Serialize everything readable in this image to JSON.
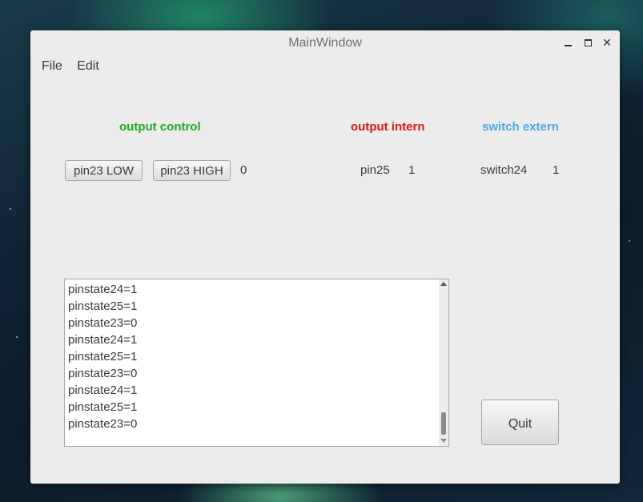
{
  "window": {
    "title": "MainWindow"
  },
  "menu": {
    "items": [
      "File",
      "Edit"
    ]
  },
  "headings": {
    "output_control": "output control",
    "output_intern": "output intern",
    "switch_extern": "switch extern"
  },
  "controls": {
    "pin23_low_label": "pin23 LOW",
    "pin23_high_label": "pin23 HIGH",
    "output_value": "0",
    "pin25_label": "pin25",
    "pin25_value": "1",
    "switch24_label": "switch24",
    "switch24_value": "1"
  },
  "log": {
    "lines": [
      "pinstate24=1",
      "pinstate25=1",
      "pinstate23=0",
      "pinstate24=1",
      "pinstate25=1",
      "pinstate23=0",
      "pinstate24=1",
      "pinstate25=1",
      "pinstate23=0"
    ]
  },
  "quit_label": "Quit",
  "colors": {
    "output_control": "#1faa1f",
    "output_intern": "#e01515",
    "switch_extern": "#4aa8e8"
  }
}
